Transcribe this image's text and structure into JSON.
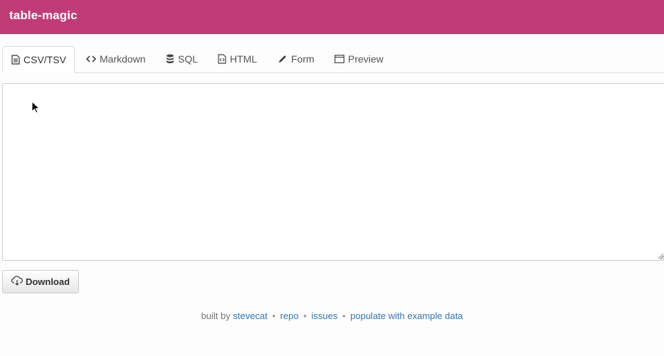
{
  "app": {
    "title": "table-magic"
  },
  "tabs": [
    {
      "label": "CSV/TSV",
      "icon": "file-text-icon",
      "active": true
    },
    {
      "label": "Markdown",
      "icon": "code-icon",
      "active": false
    },
    {
      "label": "SQL",
      "icon": "database-icon",
      "active": false
    },
    {
      "label": "HTML",
      "icon": "file-code-icon",
      "active": false
    },
    {
      "label": "Form",
      "icon": "pencil-icon",
      "active": false
    },
    {
      "label": "Preview",
      "icon": "window-icon",
      "active": false
    }
  ],
  "editor": {
    "value": ""
  },
  "actions": {
    "download_label": "Download",
    "download_icon": "cloud-download-icon"
  },
  "footer": {
    "built_by_prefix": "built by",
    "author_link": "stevecat",
    "separator": "•",
    "repo_link": "repo",
    "issues_link": "issues",
    "populate_link": "populate with example data"
  },
  "colors": {
    "header_bg": "#c03c76",
    "link": "#3276b1"
  }
}
